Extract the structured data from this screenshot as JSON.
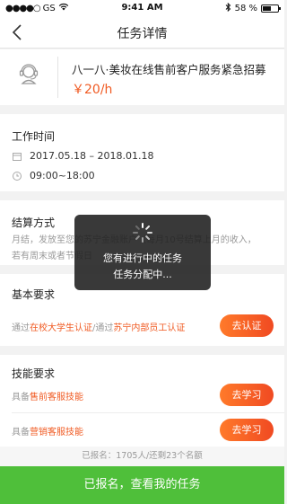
{
  "status_bar": {
    "carrier": "GS",
    "time": "9:41 AM",
    "battery_percent": "58 %",
    "battery_level": 0.58
  },
  "nav": {
    "title": "任务详情",
    "back_icon": "chevron-left-icon"
  },
  "job": {
    "icon": "headset-agent-icon",
    "title": "八一八·美妆在线售前客户服务紧急招募",
    "salary": "￥20/h"
  },
  "work_time": {
    "title": "工作时间",
    "date_range": "2017.05.18 – 2018.01.18",
    "hours": "09:00~18:00"
  },
  "settlement": {
    "title": "结算方式",
    "line1": "月结，发放至您的苏宁金融账户（每月10号结算上月的收入，",
    "line2": "若有周末或者节假日"
  },
  "basic_req": {
    "title": "基本要求",
    "prefix1": "通过",
    "hl1": "在校大学生认证",
    "sep": "/通过",
    "hl2": "苏宁内部员工认证",
    "button": "去认证"
  },
  "skill_req": {
    "title": "技能要求",
    "items": [
      {
        "prefix": "具备",
        "highlight": "售前客服技能",
        "button": "去学习"
      },
      {
        "prefix": "具备",
        "highlight": "营销客服技能",
        "button": "去学习"
      }
    ]
  },
  "signup_info": "已报名：1705人/还剩23个名额",
  "bottom_button": "已报名，查看我的任务",
  "toast": {
    "line1": "您有进行中的任务",
    "line2": "任务分配中..."
  },
  "colors": {
    "accent": "#f05a22",
    "green": "#4fbf3a"
  }
}
